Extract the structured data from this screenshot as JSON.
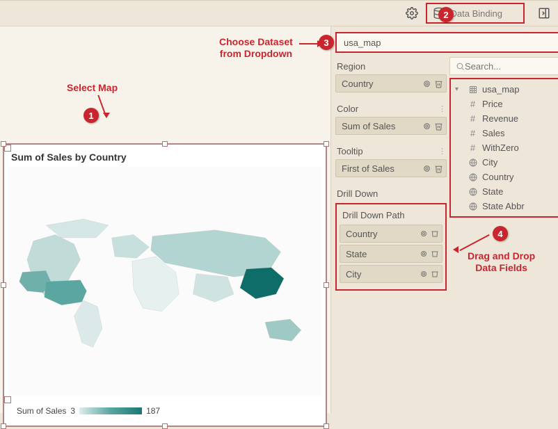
{
  "toolbar": {
    "data_binding_label": "Data Binding"
  },
  "dataset": {
    "selected": "usa_map"
  },
  "bindings": {
    "region": {
      "label": "Region",
      "field": "Country"
    },
    "color": {
      "label": "Color",
      "field": "Sum of Sales"
    },
    "tooltip": {
      "label": "Tooltip",
      "field": "First of Sales"
    },
    "drilldown": {
      "label": "Drill Down",
      "path_label": "Drill Down Path",
      "fields": [
        "Country",
        "State",
        "City"
      ]
    }
  },
  "search": {
    "placeholder": "Search..."
  },
  "fields_tree": {
    "dataset": "usa_map",
    "fields": [
      {
        "icon": "number",
        "name": "Price"
      },
      {
        "icon": "number",
        "name": "Revenue"
      },
      {
        "icon": "number",
        "name": "Sales"
      },
      {
        "icon": "number",
        "name": "WithZero"
      },
      {
        "icon": "geo",
        "name": "City"
      },
      {
        "icon": "geo",
        "name": "Country"
      },
      {
        "icon": "geo",
        "name": "State"
      },
      {
        "icon": "geo",
        "name": "State Abbr"
      }
    ]
  },
  "chart": {
    "title": "Sum of Sales by Country",
    "legend_label": "Sum of Sales",
    "legend_min": "3",
    "legend_max": "187"
  },
  "annotations": {
    "a1": "Select Map",
    "a2_line1": "Choose Dataset",
    "a2_line2": "from Dropdown",
    "a3_line1": "Drag and Drop",
    "a3_line2": "Data Fields",
    "b1": "1",
    "b2": "2",
    "b3": "3",
    "b4": "4"
  },
  "chart_data": {
    "type": "choropleth-map",
    "title": "Sum of Sales by Country",
    "measure": "Sum of Sales",
    "value_range": [
      3,
      187
    ],
    "color_scale": [
      "#e8f1f0",
      "#1a7874"
    ],
    "note": "World choropleth map; darker teal indicates higher Sum of Sales. Exact per-country values not labeled in image."
  }
}
